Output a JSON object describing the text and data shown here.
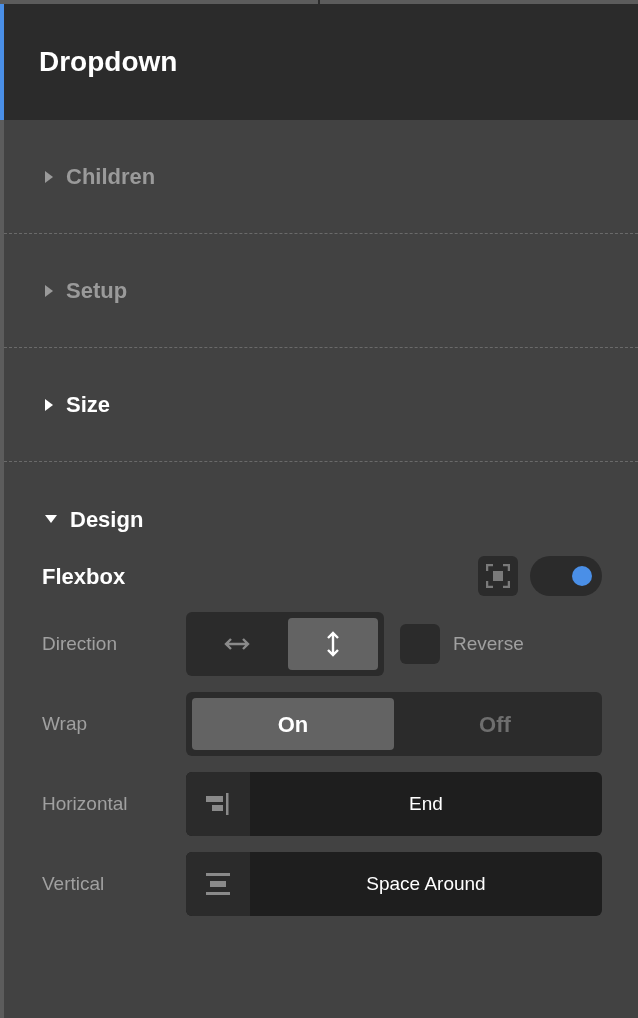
{
  "title": "Dropdown",
  "sections": [
    {
      "label": "Children",
      "expanded": false,
      "dimmed": true
    },
    {
      "label": "Setup",
      "expanded": false,
      "dimmed": true
    },
    {
      "label": "Size",
      "expanded": false,
      "dimmed": false
    },
    {
      "label": "Design",
      "expanded": true,
      "dimmed": false
    }
  ],
  "design": {
    "flexbox": {
      "label": "Flexbox",
      "on": true
    },
    "direction": {
      "label": "Direction",
      "options": [
        {
          "kind": "horizontal",
          "selected": false
        },
        {
          "kind": "vertical",
          "selected": true
        }
      ],
      "reverse": {
        "label": "Reverse",
        "checked": false
      }
    },
    "wrap": {
      "label": "Wrap",
      "options": [
        {
          "label": "On",
          "selected": true
        },
        {
          "label": "Off",
          "selected": false
        }
      ]
    },
    "selects": [
      {
        "label": "Horizontal",
        "kind": "align-end",
        "value": "End"
      },
      {
        "label": "Vertical",
        "kind": "space-around",
        "value": "Space Around"
      }
    ]
  }
}
